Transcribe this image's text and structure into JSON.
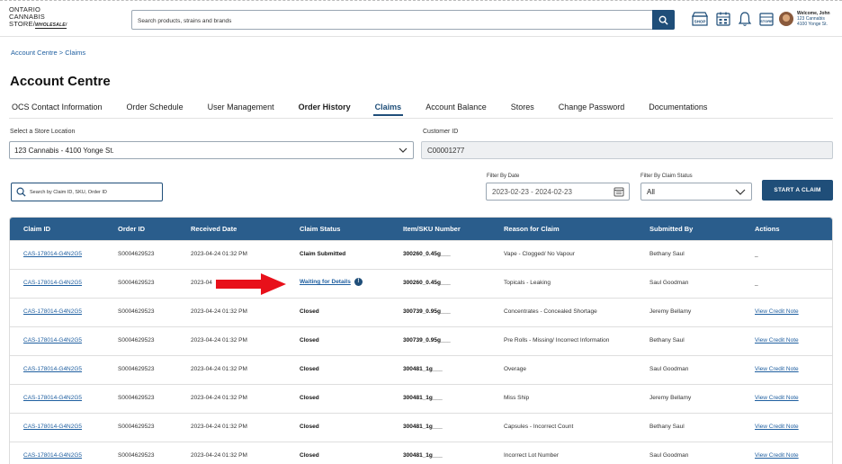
{
  "header": {
    "logo_line1": "ONTARIO",
    "logo_line2": "CANNABIS",
    "logo_line3": "STORE/",
    "logo_tag": "WHOLESALE/",
    "search_placeholder": "Search products, strains and brands",
    "shop_label": "SHOP",
    "store_label": "STORE",
    "welcome": "Welcome, John",
    "store_name": "123 Cannabis",
    "store_address": "4100 Yonge St."
  },
  "breadcrumb": "Account Centre > Claims",
  "page_title": "Account Centre",
  "tabs": [
    {
      "label": "OCS Contact Information"
    },
    {
      "label": "Order Schedule"
    },
    {
      "label": "User Management"
    },
    {
      "label": "Order History"
    },
    {
      "label": "Claims"
    },
    {
      "label": "Account Balance"
    },
    {
      "label": "Stores"
    },
    {
      "label": "Change Password"
    },
    {
      "label": "Documentations"
    }
  ],
  "filters": {
    "store_label": "Select a Store Location",
    "store_value": "123 Cannabis - 4100 Yonge St.",
    "customer_label": "Customer ID",
    "customer_value": "C00001277",
    "claim_search_placeholder": "Search by Claim ID, SKU, Order ID",
    "date_label": "Filter By Date",
    "date_value": "2023-02-23  -  2024-02-23",
    "status_label": "Filter By Claim Status",
    "status_value": "All",
    "start_claim": "START A CLAIM"
  },
  "table": {
    "headers": [
      "Claim ID",
      "Order ID",
      "Received Date",
      "Claim Status",
      "Item/SKU Number",
      "Reason for Claim",
      "Submitted By",
      "Actions"
    ],
    "rows": [
      {
        "claim_id": "CAS-178014-G4N2G5",
        "order_id": "S0004629523",
        "date": "2023-04-24 01:32 PM",
        "status": "Claim Submitted",
        "sku": "300260_0.45g___",
        "reason": "Vape - Clogged/ No Vapour",
        "submitted_by": "Bethany Saul",
        "action": "_"
      },
      {
        "claim_id": "CAS-178014-G4N2G5",
        "order_id": "S0004629523",
        "date": "2023-04",
        "status": "Waiting for Details",
        "sku": "300260_0.45g___",
        "reason": "Topicals - Leaking",
        "submitted_by": "Saul Goodman",
        "action": "_"
      },
      {
        "claim_id": "CAS-178014-G4N2G5",
        "order_id": "S0004629523",
        "date": "2023-04-24 01:32 PM",
        "status": "Closed",
        "sku": "300739_0.95g___",
        "reason": "Concentrates - Concealed Shortage",
        "submitted_by": "Jeremy Bellamy",
        "action": "View Credit Note"
      },
      {
        "claim_id": "CAS-178014-G4N2G5",
        "order_id": "S0004629523",
        "date": "2023-04-24 01:32 PM",
        "status": "Closed",
        "sku": "300739_0.95g___",
        "reason": "Pre Rolls - Missing/ Incorrect Information",
        "submitted_by": "Bethany Saul",
        "action": "View Credit Note"
      },
      {
        "claim_id": "CAS-178014-G4N2G5",
        "order_id": "S0004629523",
        "date": "2023-04-24 01:32 PM",
        "status": "Closed",
        "sku": "300481_1g___",
        "reason": "Overage",
        "submitted_by": "Saul Goodman",
        "action": "View Credit Note"
      },
      {
        "claim_id": "CAS-178014-G4N2G5",
        "order_id": "S0004629523",
        "date": "2023-04-24 01:32 PM",
        "status": "Closed",
        "sku": "300481_1g___",
        "reason": "Miss Ship",
        "submitted_by": "Jeremy Bellamy",
        "action": "View Credit Note"
      },
      {
        "claim_id": "CAS-178014-G4N2G5",
        "order_id": "S0004629523",
        "date": "2023-04-24 01:32 PM",
        "status": "Closed",
        "sku": "300481_1g___",
        "reason": "Capsules - Incorrect Count",
        "submitted_by": "Bethany Saul",
        "action": "View Credit Note"
      },
      {
        "claim_id": "CAS-178014-G4N2G5",
        "order_id": "S0004629523",
        "date": "2023-04-24 01:32 PM",
        "status": "Closed",
        "sku": "300481_1g___",
        "reason": "Incorrect Lot Number",
        "submitted_by": "Saul Goodman",
        "action": "View Credit Note"
      }
    ]
  },
  "colors": {
    "primary": "#1f4e79",
    "table_header": "#2a5d8c",
    "arrow": "#e8101a"
  }
}
